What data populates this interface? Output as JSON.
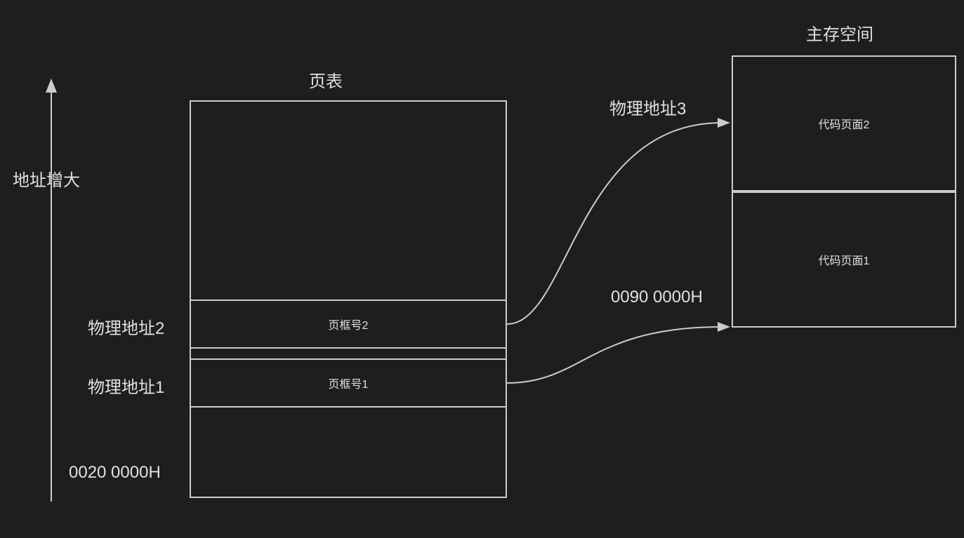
{
  "arrow_axis": {
    "label": "地址增大"
  },
  "page_table": {
    "title": "页表",
    "rows": {
      "frame2": {
        "left_label": "物理地址2",
        "content": "页框号2"
      },
      "frame1": {
        "left_label": "物理地址1",
        "content": "页框号1"
      }
    },
    "base_address": "0020 0000H"
  },
  "main_memory": {
    "title": "主存空间",
    "cells": {
      "code_page2": "代码页面2",
      "code_page1": "代码页面1"
    },
    "base_address": "0090 0000H",
    "pointer_label": "物理地址3"
  }
}
